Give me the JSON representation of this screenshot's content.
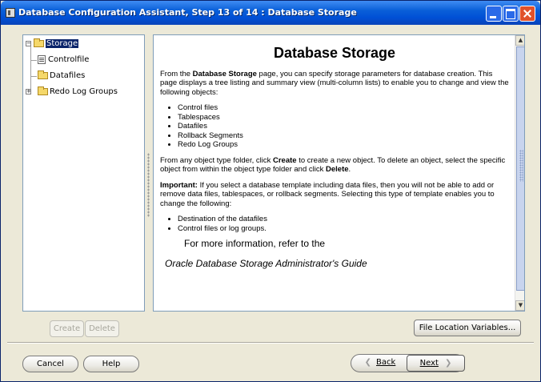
{
  "window": {
    "title": "Database Configuration Assistant, Step 13 of 14 : Database Storage"
  },
  "tree": {
    "root": {
      "label": "Storage",
      "icon": "folder-open-icon"
    },
    "children": [
      {
        "label": "Controlfile",
        "icon": "controlfile-icon"
      },
      {
        "label": "Datafiles",
        "icon": "folder-icon"
      },
      {
        "label": "Redo Log Groups",
        "icon": "folder-icon"
      }
    ]
  },
  "content": {
    "heading": "Database Storage",
    "intro_prefix": "From the ",
    "intro_bold": "Database Storage",
    "intro_rest": " page, you can specify storage parameters for database creation. This page displays a tree listing and summary view (multi-column lists) to enable you to change and view the following objects:",
    "objects": [
      "Control files",
      "Tablespaces",
      "Datafiles",
      "Rollback Segments",
      "Redo Log Groups"
    ],
    "para2_a": "From any object type folder, click ",
    "para2_b": "Create",
    "para2_c": " to create a new object. To delete an object, select the specific object from within the object type folder and click ",
    "para2_d": "Delete",
    "para2_e": ".",
    "important_label": "Important:",
    "important_text": " If you select a database template including data files, then you will not be able to add or remove data files, tablespaces, or rollback segments. Selecting this type of template enables you to change the following:",
    "changeable": [
      "Destination of the datafiles",
      "Control files or log groups."
    ],
    "more_info": "For more information, refer to the",
    "guide": "Oracle Database Storage Administrator's Guide"
  },
  "buttons": {
    "create": "Create",
    "delete": "Delete",
    "file_location": "File Location Variables...",
    "cancel": "Cancel",
    "help": "Help",
    "back": "Back",
    "next": "Next"
  }
}
